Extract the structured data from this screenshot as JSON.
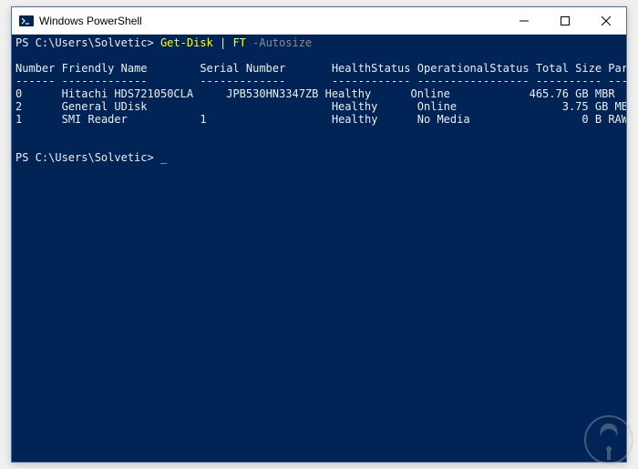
{
  "window": {
    "title": "Windows PowerShell"
  },
  "prompt1": {
    "path": "PS C:\\Users\\Solvetic> ",
    "command": "Get-Disk ",
    "pipe": "| ",
    "ft": "FT ",
    "flag": "-Autosize"
  },
  "headers": {
    "c0": "Number",
    "c1": "Friendly Name",
    "c2": "Serial Number",
    "c3": "HealthStatus",
    "c4": "OperationalStatus",
    "c5": "Total Size",
    "c6": "Partition Style"
  },
  "dashes": {
    "c0": "------",
    "c1": "-------------",
    "c2": "-------------",
    "c3": "------------",
    "c4": "-----------------",
    "c5": "----------",
    "c6": "---------------"
  },
  "rows": [
    {
      "num": "0",
      "name": "Hitachi HDS721050CLA",
      "serial": "     JPB530HN3347ZB",
      "health": "Healthy",
      "op": "Online",
      "size": "   465.76 GB",
      "part": "MBR"
    },
    {
      "num": "2",
      "name": "General UDisk",
      "serial": "",
      "health": "Healthy",
      "op": "Online",
      "size": "     3.75 GB",
      "part": "MBR"
    },
    {
      "num": "1",
      "name": "SMI Reader",
      "serial": "1",
      "health": "Healthy",
      "op": "No Media",
      "size": "        0 B",
      "part": "RAW"
    }
  ],
  "prompt2": {
    "path": "PS C:\\Users\\Solvetic> "
  }
}
